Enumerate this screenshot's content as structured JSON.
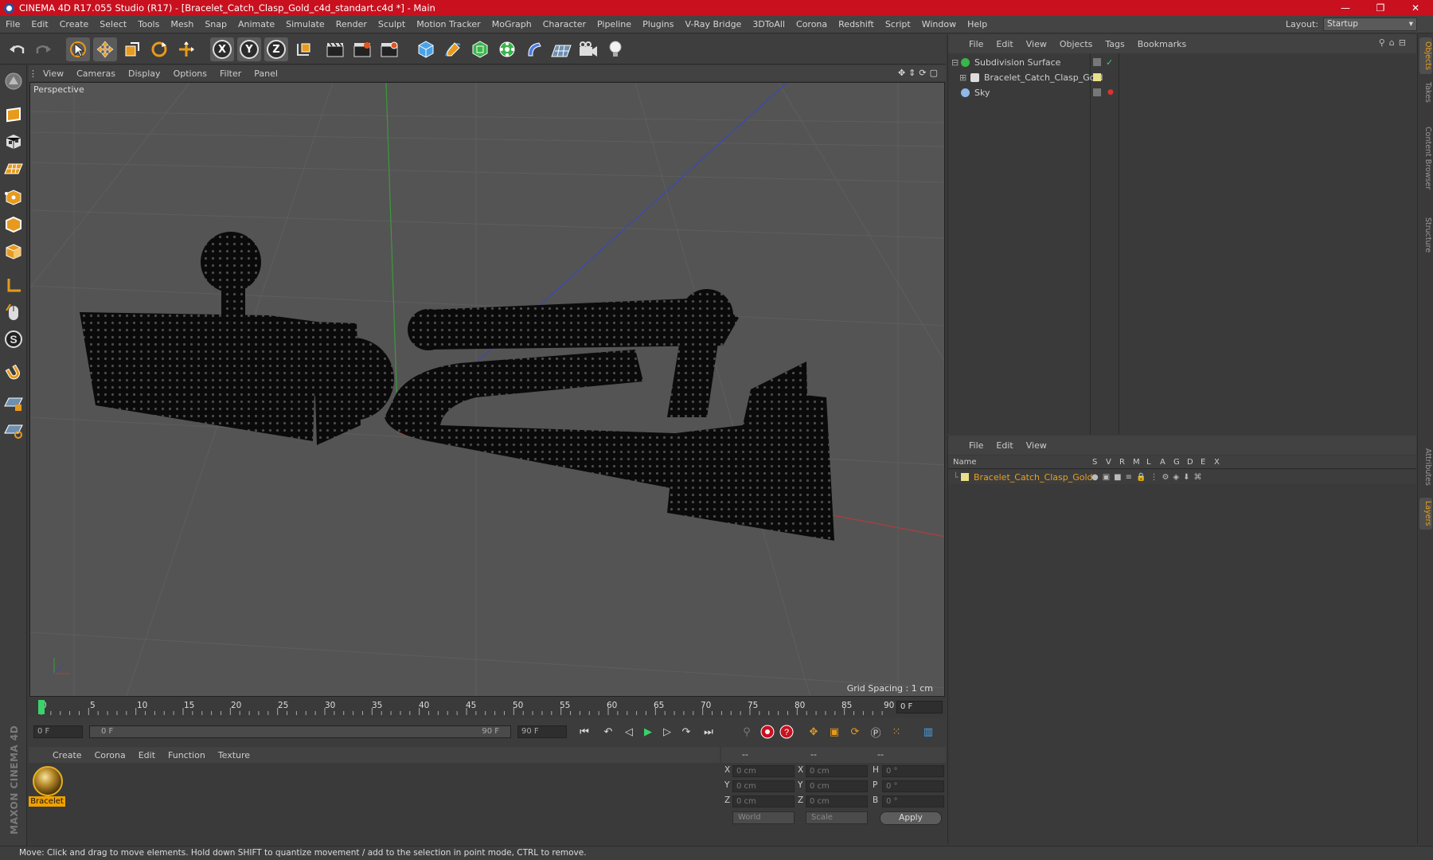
{
  "window": {
    "title": "CINEMA 4D R17.055 Studio (R17) - [Bracelet_Catch_Clasp_Gold_c4d_standart.c4d *] - Main",
    "controls": [
      "—",
      "❐",
      "✕"
    ]
  },
  "menubar": {
    "items": [
      "File",
      "Edit",
      "Create",
      "Select",
      "Tools",
      "Mesh",
      "Snap",
      "Animate",
      "Simulate",
      "Render",
      "Sculpt",
      "Motion Tracker",
      "MoGraph",
      "Character",
      "Pipeline",
      "Plugins",
      "V-Ray Bridge",
      "3DToAll",
      "Corona",
      "Redshift",
      "Script",
      "Window",
      "Help"
    ],
    "layout_label": "Layout:",
    "layout_value": "Startup"
  },
  "toolbar": {
    "axis_x": "X",
    "axis_y": "Y",
    "axis_z": "Z"
  },
  "viewport": {
    "menu": [
      "View",
      "Cameras",
      "Display",
      "Options",
      "Filter",
      "Panel"
    ],
    "label": "Perspective",
    "grid_spacing": "Grid Spacing : 1 cm"
  },
  "timeline": {
    "ticks": [
      "0",
      "5",
      "10",
      "15",
      "20",
      "25",
      "30",
      "35",
      "40",
      "45",
      "50",
      "55",
      "60",
      "65",
      "70",
      "75",
      "80",
      "85",
      "90"
    ],
    "current_frame": "0 F",
    "start_field": "0 F",
    "range_start": "0 F",
    "range_end": "90 F",
    "end_field": "90 F"
  },
  "material_manager": {
    "menu": [
      "Create",
      "Corona",
      "Edit",
      "Function",
      "Texture"
    ],
    "material_name": "Bracelet"
  },
  "coordinates": {
    "headers": [
      "--",
      "--",
      "--"
    ],
    "rows": [
      {
        "l1": "X",
        "v1": "0 cm",
        "l2": "X",
        "v2": "0 cm",
        "l3": "H",
        "v3": "0 °"
      },
      {
        "l1": "Y",
        "v1": "0 cm",
        "l2": "Y",
        "v2": "0 cm",
        "l3": "P",
        "v3": "0 °"
      },
      {
        "l1": "Z",
        "v1": "0 cm",
        "l2": "Z",
        "v2": "0 cm",
        "l3": "B",
        "v3": "0 °"
      }
    ],
    "world": "World",
    "scale": "Scale",
    "apply": "Apply"
  },
  "object_manager": {
    "menu": [
      "File",
      "Edit",
      "View",
      "Objects",
      "Tags",
      "Bookmarks"
    ],
    "objects": [
      "Subdivision Surface",
      "Bracelet_Catch_Clasp_Gold",
      "Sky"
    ]
  },
  "layer_manager": {
    "menu": [
      "File",
      "Edit",
      "View"
    ],
    "columns": [
      "Name",
      "S",
      "V",
      "R",
      "M",
      "L",
      "A",
      "G",
      "D",
      "E",
      "X"
    ],
    "layer_name": "Bracelet_Catch_Clasp_Gold"
  },
  "side_tabs": [
    "Objects",
    "Takes",
    "Content Browser",
    "Structure",
    "Attributes",
    "Layers"
  ],
  "status": "Move: Click and drag to move elements. Hold down SHIFT to quantize movement / add to the selection in point mode, CTRL to remove.",
  "branding": "MAXON CINEMA 4D",
  "colors": {
    "titlebar": "#c8101e",
    "accent": "#e8a020",
    "viewport": "#545454"
  }
}
